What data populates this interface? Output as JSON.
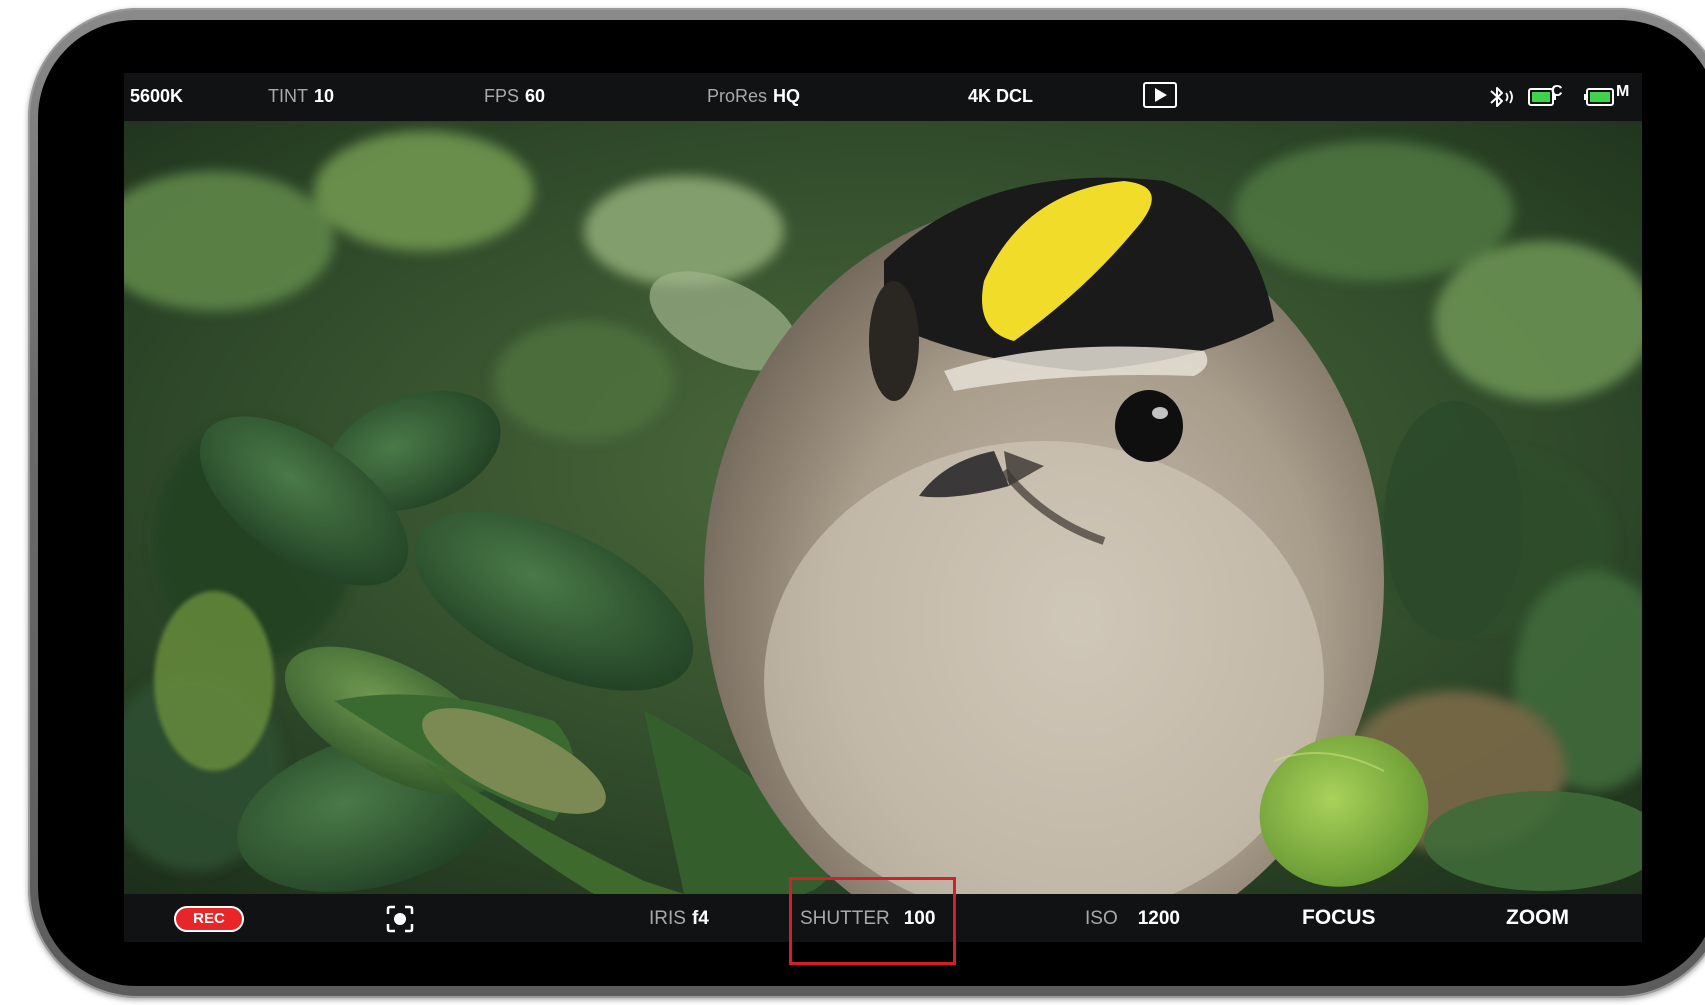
{
  "top_bar": {
    "white_balance": "5600K",
    "tint_label": "TINT",
    "tint_value": "10",
    "fps_label": "FPS",
    "fps_value": "60",
    "codec_label": "ProRes",
    "codec_value": "HQ",
    "resolution": "4K DCL",
    "play_icon": "play-icon",
    "bluetooth_icon": "bluetooth-icon",
    "camera_battery_letter": "C",
    "monitor_battery_letter": "M"
  },
  "bottom_bar": {
    "rec_label": "REC",
    "focus_frame_icon": "focus-frame-icon",
    "iris_label": "IRIS",
    "iris_value": "f4",
    "shutter_label": "SHUTTER",
    "shutter_value": "100",
    "iso_label": "ISO",
    "iso_value": "1200",
    "focus_label": "FOCUS",
    "zoom_label": "ZOOM"
  },
  "colors": {
    "rec": "#e8262a",
    "highlight": "#d0202a",
    "battery": "#3fd24a",
    "bar_background": "#111213"
  }
}
